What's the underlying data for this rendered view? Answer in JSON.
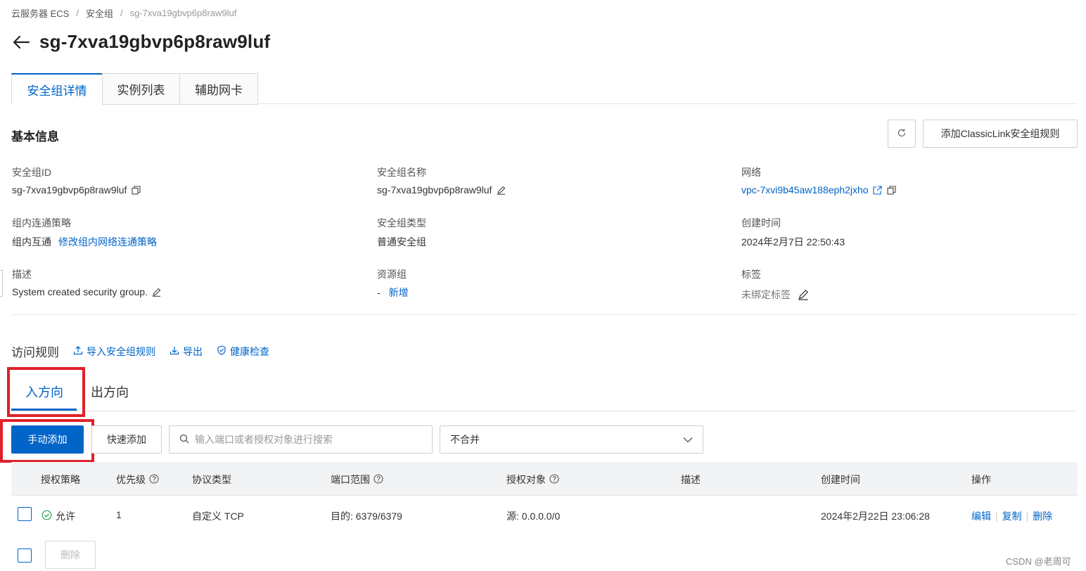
{
  "breadcrumb": {
    "items": [
      "云服务器 ECS",
      "安全组",
      "sg-7xva19gbvp6p8raw9luf"
    ],
    "separator": "/"
  },
  "header": {
    "title": "sg-7xva19gbvp6p8raw9luf",
    "back_icon": "arrow-left-icon"
  },
  "top_tabs": [
    {
      "label": "安全组详情",
      "active": true
    },
    {
      "label": "实例列表",
      "active": false
    },
    {
      "label": "辅助网卡",
      "active": false
    }
  ],
  "basic_info": {
    "title": "基本信息",
    "refresh_icon": "refresh-icon",
    "classic_button": "添加ClassicLink安全组规则",
    "fields": {
      "sg_id": {
        "label": "安全组ID",
        "value": "sg-7xva19gbvp6p8raw9luf"
      },
      "sg_name": {
        "label": "安全组名称",
        "value": "sg-7xva19gbvp6p8raw9luf"
      },
      "network": {
        "label": "网络",
        "value": "vpc-7xvi9b45aw188eph2jxho"
      },
      "intra_policy": {
        "label": "组内连通策略",
        "value": "组内互通",
        "link": "修改组内网络连通策略"
      },
      "sg_type": {
        "label": "安全组类型",
        "value": "普通安全组"
      },
      "created": {
        "label": "创建时间",
        "value": "2024年2月7日 22:50:43"
      },
      "description": {
        "label": "描述",
        "value": "System created security group."
      },
      "resource_group": {
        "label": "资源组",
        "value": "-",
        "link": "新增"
      },
      "tags": {
        "label": "标签",
        "value": "未绑定标签"
      }
    }
  },
  "rules": {
    "title": "访问规则",
    "actions": {
      "import": "导入安全组规则",
      "export": "导出",
      "health": "健康检查"
    },
    "direction_tabs": [
      {
        "label": "入方向",
        "active": true
      },
      {
        "label": "出方向",
        "active": false
      }
    ],
    "toolbar": {
      "manual_add": "手动添加",
      "quick_add": "快速添加",
      "search_placeholder": "输入端口或者授权对象进行搜索",
      "merge_select": "不合并"
    },
    "columns": [
      "授权策略",
      "优先级",
      "协议类型",
      "端口范围",
      "授权对象",
      "描述",
      "创建时间",
      "操作"
    ],
    "rows": [
      {
        "policy": "允许",
        "priority": "1",
        "protocol": "自定义 TCP",
        "port": "目的: 6379/6379",
        "source": "源: 0.0.0.0/0",
        "description": "",
        "created": "2024年2月22日 23:06:28",
        "ops": [
          "编辑",
          "复制",
          "删除"
        ]
      }
    ],
    "bulk_delete": "删除"
  },
  "watermark": "CSDN @老周可",
  "colors": {
    "accent": "#0064c8",
    "highlight_box": "#e0212a",
    "success": "#2aa84a"
  }
}
